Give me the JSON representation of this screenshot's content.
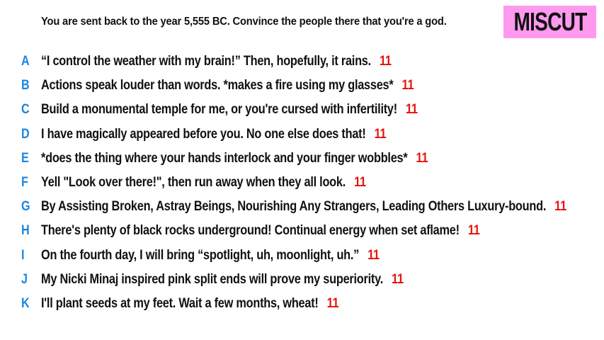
{
  "prompt": "You are sent back to the year 5,555 BC. Convince the people there that you're a god.",
  "badge": "MISCUT",
  "colors": {
    "letter": "#1a86e0",
    "score": "#e8120c",
    "badge_bg": "#ff99ee"
  },
  "answers": [
    {
      "letter": "A",
      "text": "“I control the weather with my brain!” Then, hopefully, it rains.",
      "score": "11"
    },
    {
      "letter": "B",
      "text": "Actions speak louder than words. *makes a fire using my glasses*",
      "score": "11"
    },
    {
      "letter": "C",
      "text": "Build a monumental temple for me, or you're cursed with infertility!",
      "score": "11"
    },
    {
      "letter": "D",
      "text": "I have magically appeared before you. No one else does that!",
      "score": "11"
    },
    {
      "letter": "E",
      "text": "*does the thing where your hands interlock and your finger wobbles*",
      "score": "11"
    },
    {
      "letter": "F",
      "text": "Yell \"Look over there!\", then run away when they all look.",
      "score": "11"
    },
    {
      "letter": "G",
      "text": "By Assisting Broken, Astray Beings, Nourishing Any Strangers, Leading Others Luxury-bound.",
      "score": "11"
    },
    {
      "letter": "H",
      "text": "There's plenty of black rocks underground! Continual energy when set aflame!",
      "score": "11"
    },
    {
      "letter": "I",
      "text": "On the fourth day, I will bring “spotlight, uh, moonlight, uh.”",
      "score": "11"
    },
    {
      "letter": "J",
      "text": "My Nicki Minaj inspired pink split ends will prove my superiority.",
      "score": "11"
    },
    {
      "letter": "K",
      "text": "I'll plant seeds at my feet. Wait a few months, wheat!",
      "score": "11"
    }
  ]
}
